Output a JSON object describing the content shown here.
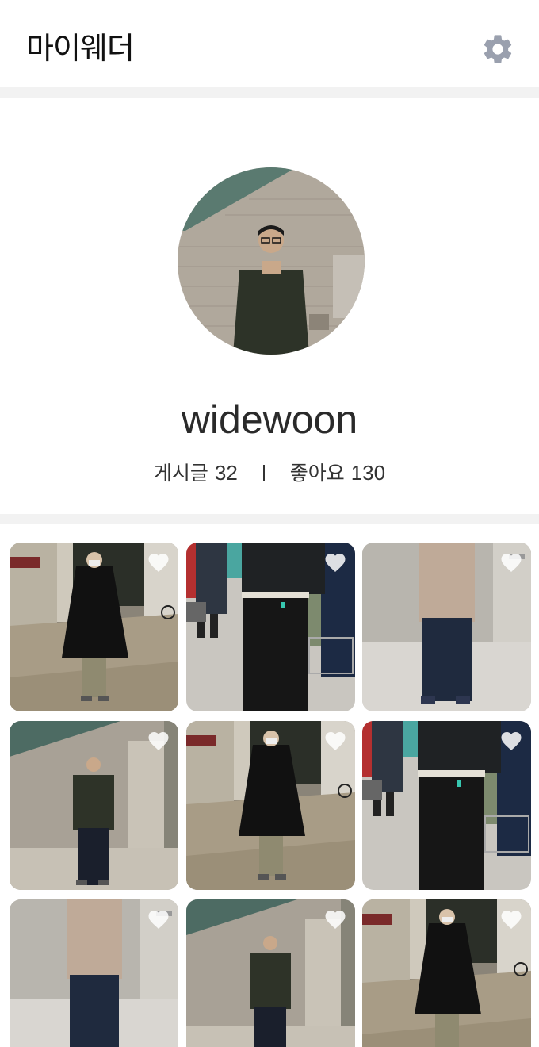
{
  "header": {
    "title": "마이웨더",
    "settings_icon": "gear-icon"
  },
  "profile": {
    "avatar_icon": "profile-photo",
    "username": "widewoon",
    "posts_label": "게시글",
    "posts_count": "32",
    "likes_label": "좋아요",
    "likes_count": "130"
  },
  "posts": [
    {
      "scene": "black-long-coat-courtyard",
      "liked": false
    },
    {
      "scene": "black-jacket-clothing-rack",
      "liked": false
    },
    {
      "scene": "beige-sweater-door",
      "liked": false
    },
    {
      "scene": "dark-fleece-building",
      "liked": false
    },
    {
      "scene": "black-long-coat-courtyard",
      "liked": false
    },
    {
      "scene": "black-jacket-clothing-rack",
      "liked": false
    },
    {
      "scene": "beige-sweater-door",
      "liked": false
    },
    {
      "scene": "dark-fleece-building",
      "liked": false
    },
    {
      "scene": "black-long-coat-courtyard",
      "liked": false
    }
  ],
  "colors": {
    "settings_icon": "#9aa0ae",
    "divider": "#f2f2f2",
    "heart": "#ffffff"
  }
}
